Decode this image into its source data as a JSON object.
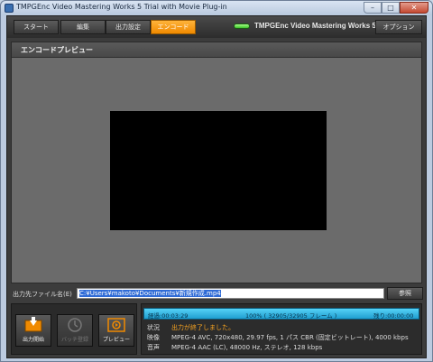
{
  "window": {
    "title": "TMPGEnc Video Mastering Works 5 Trial with Movie Plug-in",
    "minimize": "–",
    "maximize": "□",
    "close": "✕"
  },
  "topbar": {
    "tabs": [
      {
        "label": "スタート",
        "active": false
      },
      {
        "label": "編集",
        "active": false
      },
      {
        "label": "出力設定",
        "active": false
      },
      {
        "label": "エンコード",
        "active": true
      }
    ],
    "brand": "TMPGEnc Video Mastering Works 5",
    "options_label": "オプション"
  },
  "preview": {
    "title": "エンコードプレビュー"
  },
  "output": {
    "label": "出力先ファイル名(E)",
    "value": "C:¥Users¥makoto¥Documents¥新規作成.mp4",
    "browse_label": "参照"
  },
  "actions": {
    "start": "出力開始",
    "batch": "バッチ登録",
    "preview": "プレビュー"
  },
  "status": {
    "elapsed": "経過:00:03:29",
    "progress_text": "100% ( 32905/32905 フレーム )",
    "progress_fraction": 1.0,
    "remaining": "残り:00:00:00",
    "state_label": "状況",
    "state_value": "出力が終了しました。",
    "video_label": "映像",
    "video_value": "MPEG-4 AVC, 720x480, 29.97 fps, 1 パス CBR (固定ビットレート), 4000 kbps",
    "audio_label": "音声",
    "audio_value": "MPEG-4 AAC (LC), 48000 Hz, ステレオ, 128 kbps"
  },
  "colors": {
    "accent_tab": "#f08a00",
    "progress": "#1f9ed0",
    "status_done": "#f7a321"
  }
}
